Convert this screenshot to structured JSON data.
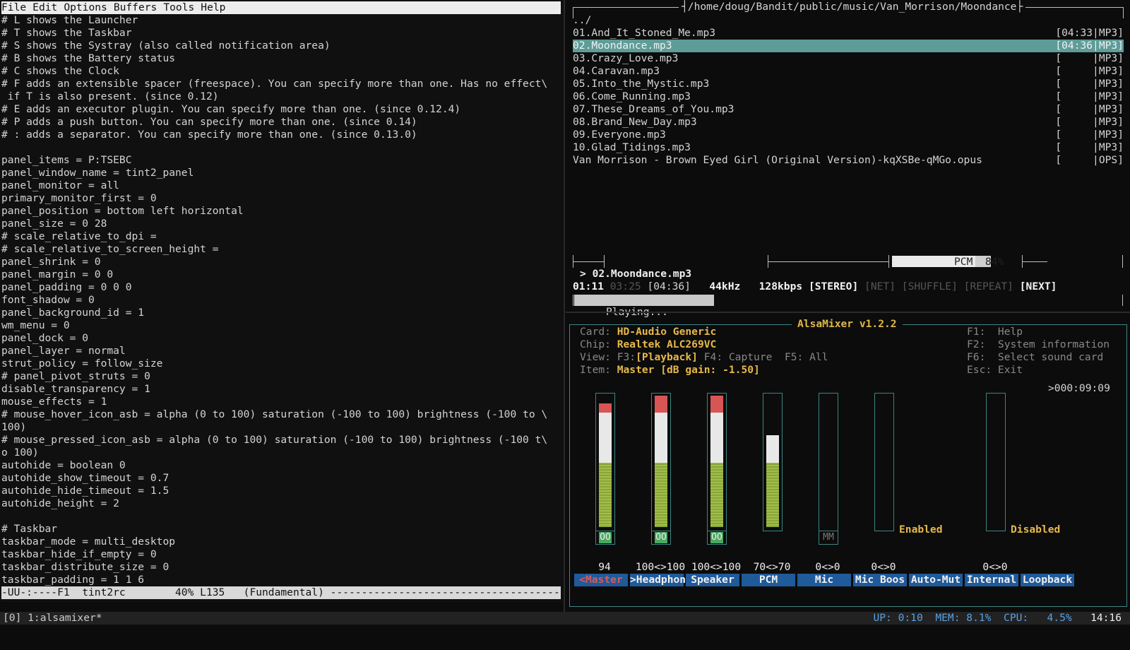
{
  "emacs": {
    "menu": [
      "File",
      "Edit",
      "Options",
      "Buffers",
      "Tools",
      "Help"
    ],
    "lines": [
      "# L shows the Launcher",
      "# T shows the Taskbar",
      "# S shows the Systray (also called notification area)",
      "# B shows the Battery status",
      "# C shows the Clock",
      "# F adds an extensible spacer (freespace). You can specify more than one. Has no effect\\",
      " if T is also present. (since 0.12)",
      "# E adds an executor plugin. You can specify more than one. (since 0.12.4)",
      "# P adds a push button. You can specify more than one. (since 0.14)",
      "# : adds a separator. You can specify more than one. (since 0.13.0)",
      "",
      "panel_items = P:TSEBC",
      "panel_window_name = tint2_panel",
      "panel_monitor = all",
      "primary_monitor_first = 0",
      "panel_position = bottom left horizontal",
      "panel_size = 0 28",
      "# scale_relative_to_dpi =",
      "# scale_relative_to_screen_height =",
      "panel_shrink = 0",
      "panel_margin = 0 0",
      "panel_padding = 0 0 0",
      "font_shadow = 0",
      "panel_background_id = 1",
      "wm_menu = 0",
      "panel_dock = 0",
      "panel_layer = normal",
      "strut_policy = follow_size",
      "# panel_pivot_struts = 0",
      "disable_transparency = 1",
      "mouse_effects = 1",
      "# mouse_hover_icon_asb = alpha (0 to 100) saturation (-100 to 100) brightness (-100 to \\",
      "100)",
      "# mouse_pressed_icon_asb = alpha (0 to 100) saturation (-100 to 100) brightness (-100 t\\",
      "o 100)",
      "autohide = boolean 0",
      "autohide_show_timeout = 0.7",
      "autohide_hide_timeout = 1.5",
      "autohide_height = 2",
      "",
      "# Taskbar",
      "taskbar_mode = multi_desktop",
      "taskbar_hide_if_empty = 0",
      "taskbar_distribute_size = 0",
      "taskbar_padding = 1 1 6"
    ],
    "modeline": "-UU-:----F1  tint2rc        40% L135   (Fundamental) --------------------------------------"
  },
  "cmus": {
    "path": "/home/doug/Bandit/public/music/Van_Morrison/Moondance",
    "files": [
      {
        "name": "../",
        "dur": ""
      },
      {
        "name": "01.And_It_Stoned_Me.mp3",
        "dur": "[04:33|MP3]"
      },
      {
        "name": "02.Moondance.mp3",
        "dur": "[04:36|MP3]",
        "selected": true
      },
      {
        "name": "03.Crazy_Love.mp3",
        "dur": "[     |MP3]"
      },
      {
        "name": "04.Caravan.mp3",
        "dur": "[     |MP3]"
      },
      {
        "name": "05.Into_the_Mystic.mp3",
        "dur": "[     |MP3]"
      },
      {
        "name": "06.Come_Running.mp3",
        "dur": "[     |MP3]"
      },
      {
        "name": "07.These_Dreams_of_You.mp3",
        "dur": "[     |MP3]"
      },
      {
        "name": "08.Brand_New_Day.mp3",
        "dur": "[     |MP3]"
      },
      {
        "name": "09.Everyone.mp3",
        "dur": "[     |MP3]"
      },
      {
        "name": "10.Glad_Tidings.mp3",
        "dur": "[     |MP3]"
      },
      {
        "name": "Van Morrison - Brown Eyed Girl (Original Version)-kqXSBe-qMGo.opus",
        "dur": "[     |OPS]"
      }
    ],
    "status": "Playing...",
    "pcm_label": "PCM  84%",
    "pcm_level": 0.84,
    "total_time": ">000:09:09",
    "now_playing": "> 02.Moondance.mp3",
    "elapsed": "01:11",
    "remaining": "03:25",
    "duration": "[04:36]",
    "rate": "44kHz",
    "bitrate": "128kbps",
    "stereo": "[STEREO]",
    "net": "[NET]",
    "shuffle": "[SHUFFLE]",
    "repeat": "[REPEAT]",
    "next": "[NEXT]",
    "progress": 0.257
  },
  "alsa": {
    "title": "AlsaMixer v1.2.2",
    "card_k": "Card:",
    "card_v": "HD-Audio Generic",
    "chip_k": "Chip:",
    "chip_v": "Realtek ALC269VC",
    "view_k": "View:",
    "view_f3": "F3:",
    "view_playback": "[Playback]",
    "view_rest": " F4: Capture  F5: All",
    "item_k": "Item:",
    "item_v": "Master [dB gain: -1.50]",
    "keys": [
      "F1:  Help",
      "F2:  System information",
      "F6:  Select sound card",
      "Esc: Exit"
    ],
    "channels": [
      {
        "label": "<Master",
        "value": "94",
        "level": 0.94,
        "oo": "OO",
        "active": true
      },
      {
        "label": ">Headphon",
        "value": "100<>100",
        "level": 1.0,
        "oo": "OO"
      },
      {
        "label": "Speaker",
        "value": "100<>100",
        "level": 1.0,
        "oo": "OO"
      },
      {
        "label": "PCM",
        "value": "70<>70",
        "level": 0.7,
        "oo": ""
      },
      {
        "label": "Mic",
        "value": "0<>0",
        "level": 0,
        "oo": "MM"
      },
      {
        "label": "Mic Boos",
        "value": "0<>0",
        "level": 0,
        "oo": ""
      },
      {
        "label": "Auto-Mut",
        "value": "",
        "level": null,
        "state": "Enabled"
      },
      {
        "label": "Internal",
        "value": "0<>0",
        "level": 0,
        "oo": ""
      },
      {
        "label": "Loopback",
        "value": "",
        "level": null,
        "state": "Disabled"
      }
    ]
  },
  "tmux": {
    "window": "[0] 1:alsamixer*",
    "up_k": "UP:",
    "up_v": "0:10",
    "mem_k": "MEM:",
    "mem_v": "8.1%",
    "cpu_k": "CPU:",
    "cpu_v": "4.5%",
    "clock": "14:16"
  },
  "colors": {
    "selection": "#5e9c98",
    "mixer_frame": "#3d8583",
    "mixer_accent": "#e6b84c",
    "label_bg": "#1f5a9a"
  }
}
